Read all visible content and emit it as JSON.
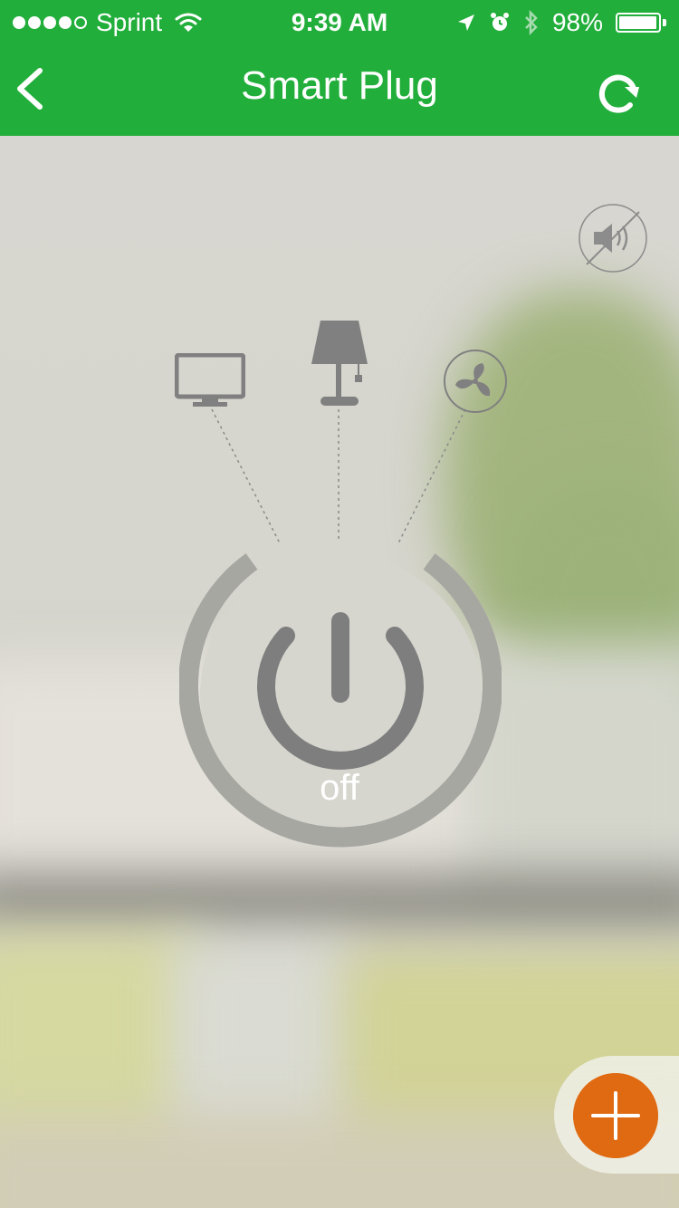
{
  "status_bar": {
    "carrier": "Sprint",
    "time": "9:39 AM",
    "battery_percent": "98%",
    "battery_level": 0.98,
    "signal_bars": 4,
    "signal_total": 5
  },
  "header": {
    "title": "Smart Plug",
    "back_icon": "chevron-left-icon",
    "refresh_icon": "refresh-icon"
  },
  "controls": {
    "mute_icon": "speaker-muted-icon",
    "appliances": [
      "tv-icon",
      "lamp-icon",
      "fan-icon"
    ],
    "power_state": "off",
    "add_icon": "plus-icon"
  },
  "colors": {
    "header_bg": "#22ae3b",
    "fab_bg": "#e06a12",
    "icon_gray": "#7f7f7f"
  }
}
